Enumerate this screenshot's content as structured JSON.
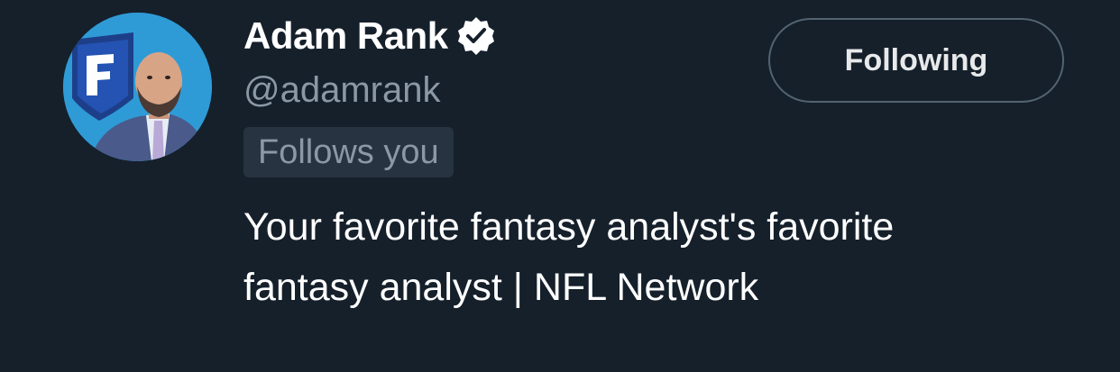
{
  "profile": {
    "display_name": "Adam Rank",
    "handle": "@adamrank",
    "follows_you_label": "Follows you",
    "bio": "Your favorite fantasy analyst's favorite fantasy analyst | NFL Network",
    "verified": true,
    "avatar_icon": "profile-photo-with-fantasy-logo"
  },
  "actions": {
    "follow_button_label": "Following"
  },
  "colors": {
    "background": "#15202b",
    "primary_text": "#ffffff",
    "secondary_text": "#8b98a5",
    "badge_background": "#273340",
    "button_border": "#536471",
    "avatar_background": "#2f9bd6"
  }
}
